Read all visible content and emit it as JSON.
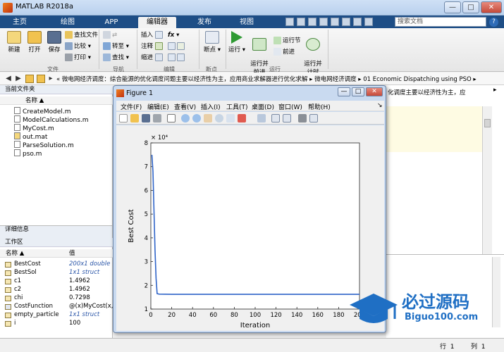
{
  "window": {
    "title": "MATLAB R2018a",
    "min": "—",
    "max": "□",
    "close": "✕"
  },
  "tabs": [
    {
      "label": "主页"
    },
    {
      "label": "绘图"
    },
    {
      "label": "APP"
    },
    {
      "label": "编辑器",
      "active": true
    },
    {
      "label": "发布"
    },
    {
      "label": "视图"
    }
  ],
  "search": {
    "placeholder": "搜索文档"
  },
  "ribbon": {
    "file": {
      "new": "新建",
      "open": "打开",
      "save": "保存",
      "find_files": "查找文件",
      "compare": "比较",
      "print": "打印",
      "group": "文件"
    },
    "navigate": {
      "goto": "转至",
      "find": "查找",
      "group": "导航"
    },
    "edit": {
      "insert": "插入",
      "comment": "注释",
      "indent": "缩进",
      "fx": "fx",
      "group": "编辑"
    },
    "breakpoints": {
      "label": "断点",
      "group": "断点"
    },
    "run": {
      "run": "运行",
      "run_advance": "运行并\n前进",
      "run_section": "运行节",
      "advance": "前进",
      "run_time": "运行并\n计时",
      "group": "运行"
    }
  },
  "address": {
    "path": "«  微电网经济调度：综合能源的优化调度问题主要以经济性为主，应用商业求解器进行优化求解  ▸  微电网经济调度  ▸  01 Economic Dispatching using PSO  ▸"
  },
  "current_folder": {
    "title": "当前文件夹",
    "col_name": "名称 ▲",
    "files": [
      "CreateModel.m",
      "ModelCalculations.m",
      "MyCost.m",
      "out.mat",
      "ParseSolution.m",
      "pso.m"
    ]
  },
  "details": {
    "title": "详细信息"
  },
  "workspace": {
    "title": "工作区",
    "col_name": "名称 ▲",
    "col_value": "值",
    "vars": [
      {
        "name": "BestCost",
        "value": "200x1 double",
        "italic": true
      },
      {
        "name": "BestSol",
        "value": "1x1 struct",
        "italic": true
      },
      {
        "name": "c1",
        "value": "1.4962"
      },
      {
        "name": "c2",
        "value": "1.4962"
      },
      {
        "name": "chi",
        "value": "0.7298"
      },
      {
        "name": "CostFunction",
        "value": "@(x)MyCost(x,m"
      },
      {
        "name": "empty_particle",
        "value": "1x1 struct",
        "italic": true
      },
      {
        "name": "i",
        "value": "100"
      }
    ]
  },
  "editor": {
    "snippet": "化调度主要以经济性为主，应"
  },
  "status": {
    "row_label": "行",
    "row": "1",
    "col_label": "列",
    "col": "1"
  },
  "figure": {
    "title": "Figure 1",
    "menus": [
      "文件(F)",
      "编辑(E)",
      "查看(V)",
      "插入(I)",
      "工具(T)",
      "桌面(D)",
      "窗口(W)",
      "帮助(H)"
    ]
  },
  "chart_data": {
    "type": "line",
    "title": "",
    "xlabel": "Iteration",
    "ylabel": "Best Cost",
    "y_exponent_label": "× 10⁴",
    "xlim": [
      0,
      200
    ],
    "ylim": [
      1,
      8
    ],
    "xticks": [
      0,
      20,
      40,
      60,
      80,
      100,
      120,
      140,
      160,
      180,
      200
    ],
    "yticks": [
      1,
      2,
      3,
      4,
      5,
      6,
      7,
      8
    ],
    "grid": false,
    "series": [
      {
        "color": "#2f64c8",
        "x": [
          1,
          2,
          3,
          4,
          5,
          6,
          8,
          20,
          50,
          100,
          150,
          200
        ],
        "y": [
          7.5,
          6.8,
          5.2,
          3.5,
          2.3,
          1.65,
          1.63,
          1.62,
          1.62,
          1.62,
          1.62,
          1.62
        ]
      }
    ]
  },
  "watermark": {
    "brand": "必过源码",
    "url": "Biguo100.com"
  }
}
